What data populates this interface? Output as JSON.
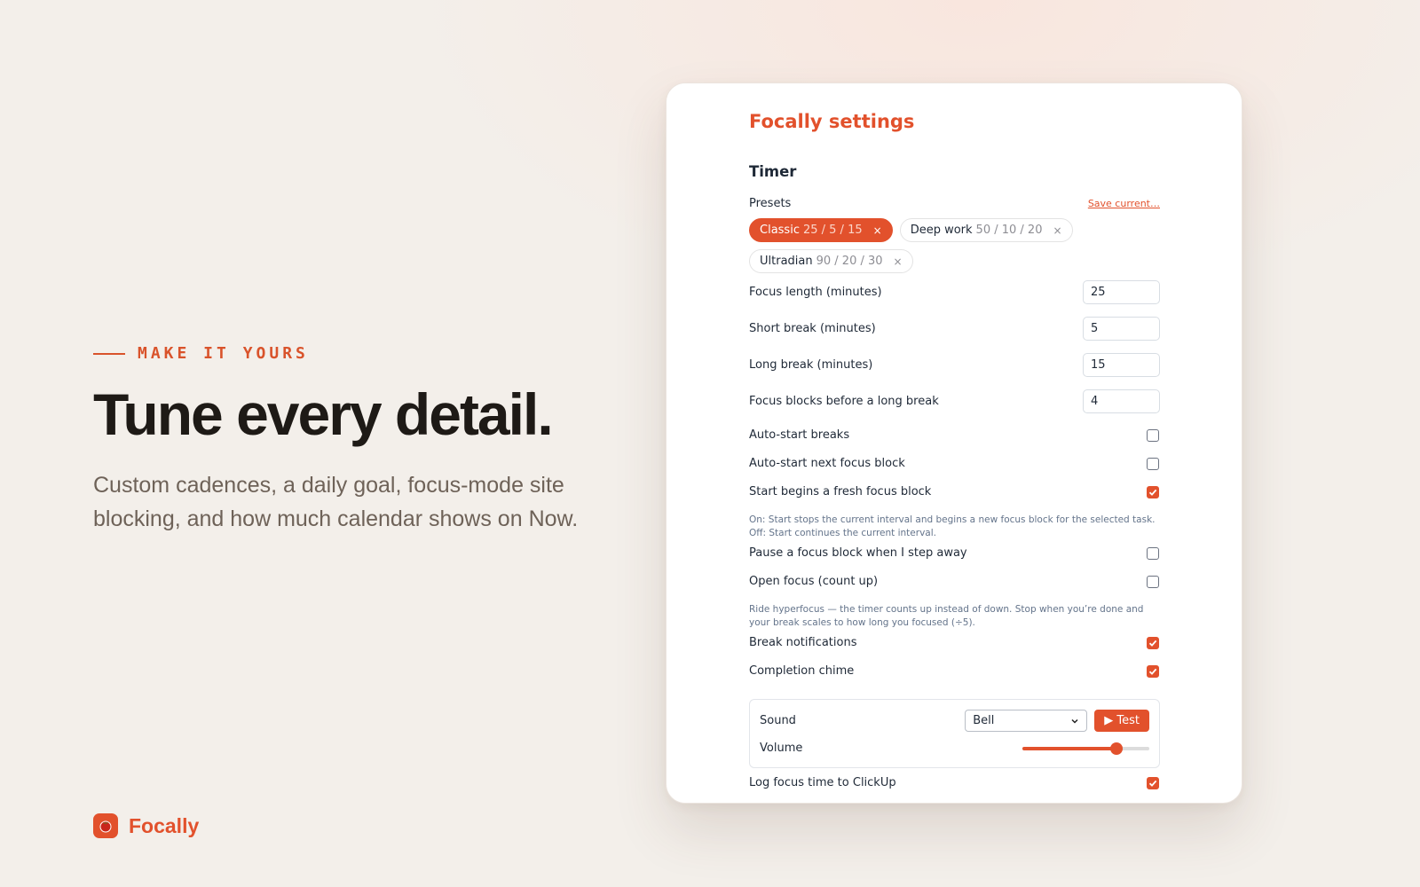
{
  "hero": {
    "eyebrow": "MAKE IT YOURS",
    "title": "Tune every detail.",
    "subtitle": "Custom cadences, a daily goal, focus-mode site blocking, and how much calendar shows on Now."
  },
  "brand": {
    "name": "Focally",
    "logo_icon": "tomato-icon"
  },
  "settings": {
    "title": "Focally settings",
    "section": "Timer",
    "presets_label": "Presets",
    "save_current": "Save current…",
    "presets": [
      {
        "name": "Classic",
        "cadence": "25 / 5 / 15",
        "remove": "×",
        "active": true
      },
      {
        "name": "Deep work",
        "cadence": "50 / 10 / 20",
        "remove": "×",
        "active": false
      },
      {
        "name": "Ultradian",
        "cadence": "90 / 20 / 30",
        "remove": "×",
        "active": false
      }
    ],
    "numbers": [
      {
        "label": "Focus length (minutes)",
        "value": "25"
      },
      {
        "label": "Short break (minutes)",
        "value": "5"
      },
      {
        "label": "Long break (minutes)",
        "value": "15"
      },
      {
        "label": "Focus blocks before a long break",
        "value": "4"
      }
    ],
    "toggles": [
      {
        "label": "Auto-start breaks",
        "checked": false
      },
      {
        "label": "Auto-start next focus block",
        "checked": false
      },
      {
        "label": "Start begins a fresh focus block",
        "checked": true,
        "help": "On: Start stops the current interval and begins a new focus block for the selected task. Off: Start continues the current interval."
      },
      {
        "label": "Pause a focus block when I step away",
        "checked": false
      },
      {
        "label": "Open focus (count up)",
        "checked": false,
        "help": "Ride hyperfocus — the timer counts up instead of down. Stop when you’re done and your break scales to how long you focused (÷5)."
      },
      {
        "label": "Break notifications",
        "checked": true
      },
      {
        "label": "Completion chime",
        "checked": true
      }
    ],
    "sound": {
      "label": "Sound",
      "selected": "Bell",
      "test_label": "▶ Test",
      "volume_label": "Volume",
      "volume_fraction": 0.77
    },
    "log_clickup": {
      "label": "Log focus time to ClickUp",
      "checked": true
    },
    "colors": {
      "accent": "#e2512c",
      "text": "#1f2937",
      "muted": "#64748b"
    }
  }
}
